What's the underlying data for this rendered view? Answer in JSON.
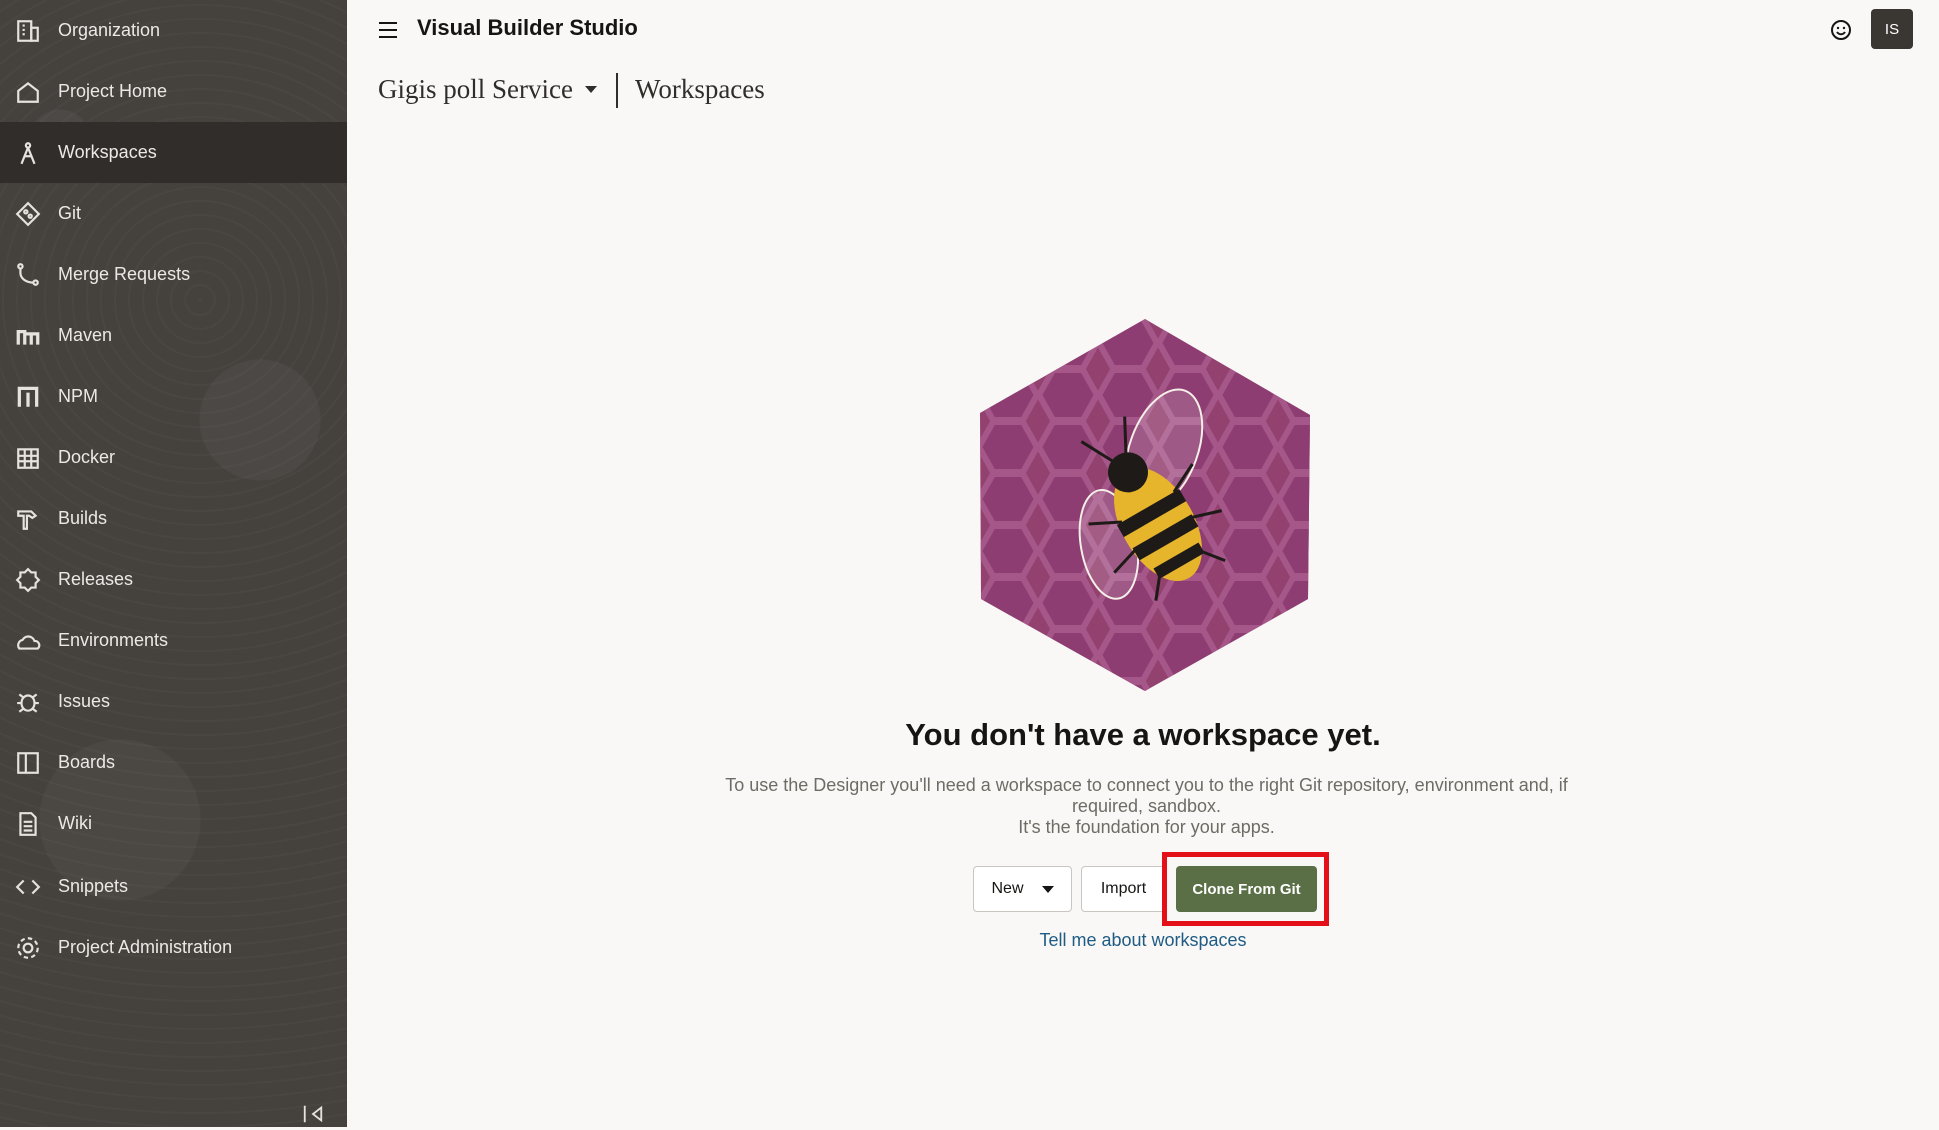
{
  "app": {
    "title": "Visual Builder Studio",
    "user_initials": "IS"
  },
  "sidebar": {
    "items": [
      {
        "label": "Organization",
        "icon": "building-icon"
      },
      {
        "label": "Project Home",
        "icon": "home-icon"
      },
      {
        "label": "Workspaces",
        "icon": "compass-icon",
        "active": true
      },
      {
        "label": "Git",
        "icon": "git-icon"
      },
      {
        "label": "Merge Requests",
        "icon": "merge-icon"
      },
      {
        "label": "Maven",
        "icon": "maven-icon"
      },
      {
        "label": "NPM",
        "icon": "npm-icon"
      },
      {
        "label": "Docker",
        "icon": "docker-icon"
      },
      {
        "label": "Builds",
        "icon": "hammer-icon"
      },
      {
        "label": "Releases",
        "icon": "badge-icon"
      },
      {
        "label": "Environments",
        "icon": "cloud-icon"
      },
      {
        "label": "Issues",
        "icon": "bug-icon"
      },
      {
        "label": "Boards",
        "icon": "board-icon"
      },
      {
        "label": "Wiki",
        "icon": "document-icon"
      },
      {
        "label": "Snippets",
        "icon": "code-icon"
      },
      {
        "label": "Project Administration",
        "icon": "settings-icon"
      }
    ]
  },
  "breadcrumb": {
    "project": "Gigis poll Service",
    "page": "Workspaces"
  },
  "empty_state": {
    "title": "You don't have a workspace yet.",
    "description_line1": "To use the Designer you'll need a workspace to connect you to the right Git repository, environment and, if required, sandbox.",
    "description_line2": "It's the foundation for your apps.",
    "new_label": "New",
    "import_label": "Import",
    "clone_label": "Clone From Git",
    "link_label": "Tell me about workspaces"
  },
  "colors": {
    "sidebar_bg": "#45423e",
    "active_bg": "#312d2a",
    "primary_button": "#5a6f45",
    "highlight": "#e3101a",
    "link": "#1f5b85"
  }
}
